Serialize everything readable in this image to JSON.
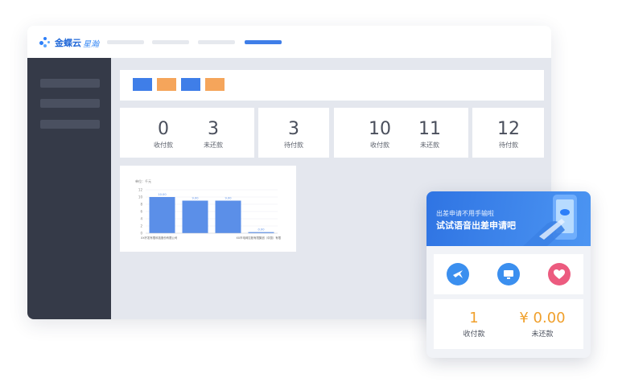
{
  "app": {
    "logo_text": "金蝶云",
    "logo_sub": "星瀚"
  },
  "nav": {
    "items": [
      "",
      "",
      "",
      ""
    ],
    "active_index": 3
  },
  "toolbar": {
    "button_colors": [
      "#3f7ee8",
      "#f5a55b",
      "#3f7ee8",
      "#f5a55b"
    ]
  },
  "stats": [
    {
      "value": "0",
      "label": "收付款"
    },
    {
      "value": "3",
      "label": "未还款"
    },
    {
      "value": "3",
      "label": "待付款"
    },
    {
      "value": "10",
      "label": "收付款"
    },
    {
      "value": "11",
      "label": "未还款"
    },
    {
      "value": "12",
      "label": "待付款"
    }
  ],
  "chart_data": {
    "type": "bar",
    "ylabel": "单位：千元",
    "categories": [
      "XX开发有限科技股份有限公司",
      "",
      "",
      "XX市电网控股有限集团（中国）有限"
    ],
    "values": [
      10,
      9,
      9,
      0.3
    ],
    "data_labels": [
      "10.00",
      "9.00",
      "9.00",
      "0.00"
    ],
    "ylim": [
      0,
      12
    ],
    "yticks": [
      0,
      2,
      4,
      6,
      8,
      10,
      12
    ],
    "colors": {
      "bar": "#5b8fe8"
    }
  },
  "phone": {
    "banner_line1": "出差申请不用手输啦",
    "banner_line2": "试试语音出差申请吧",
    "icons": [
      {
        "name": "plane-icon",
        "color": "#3b8fef"
      },
      {
        "name": "monitor-icon",
        "color": "#3b8fef"
      },
      {
        "name": "heart-icon",
        "color": "#ec5b7f"
      }
    ],
    "stats": [
      {
        "value": "1",
        "label": "收付款"
      },
      {
        "value": "¥ 0.00",
        "label": "未还款"
      }
    ]
  }
}
